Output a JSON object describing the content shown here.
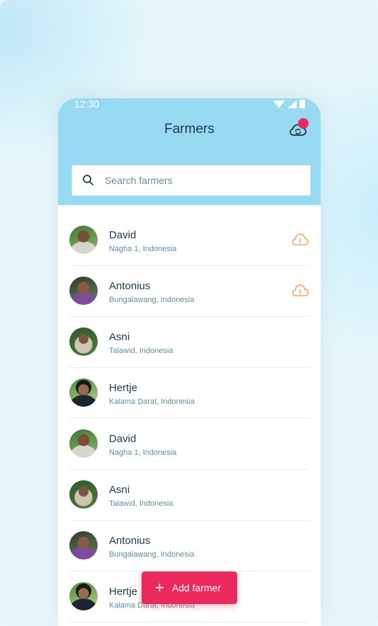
{
  "status_bar": {
    "time": "12:30"
  },
  "header": {
    "title": "Farmers",
    "sync_icon": "cloud-sync-icon",
    "notification_color": "#ea2a5c"
  },
  "search": {
    "placeholder": "Search farmers",
    "value": ""
  },
  "farmers": [
    {
      "name": "David",
      "location": "Nagha 1, Indonesia",
      "warning": true
    },
    {
      "name": "Antonius",
      "location": "Bungalawang, Indonesia",
      "warning": true
    },
    {
      "name": "Asni",
      "location": "Talawid, Indonesia",
      "warning": false
    },
    {
      "name": "Hertje",
      "location": "Kalama Darat, Indonesia",
      "warning": false
    },
    {
      "name": "David",
      "location": "Nagha 1, Indonesia",
      "warning": false
    },
    {
      "name": "Asni",
      "location": "Talawid, Indonesia",
      "warning": false
    },
    {
      "name": "Antonius",
      "location": "Bungalawang, Indonesia",
      "warning": false
    },
    {
      "name": "Hertje",
      "location": "Kalama Darat, Indonesia",
      "warning": false
    }
  ],
  "fab": {
    "label": "Add farmer",
    "icon": "plus-icon"
  },
  "colors": {
    "accent": "#ea2a5c",
    "header": "#97daf2",
    "warning": "#f0a55e",
    "text": "#1e3a4c"
  }
}
